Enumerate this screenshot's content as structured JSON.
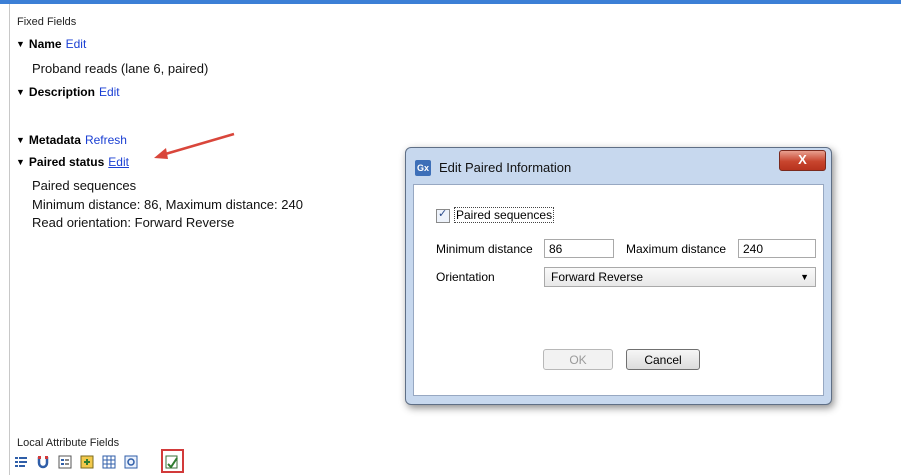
{
  "fixed_fields": {
    "title": "Fixed Fields",
    "name": {
      "label": "Name",
      "edit": "Edit",
      "value": "Proband reads (lane 6, paired)"
    },
    "description": {
      "label": "Description",
      "edit": "Edit"
    },
    "metadata": {
      "label": "Metadata",
      "refresh": "Refresh"
    },
    "paired_status": {
      "label": "Paired status",
      "edit": "Edit",
      "lines": [
        "Paired sequences",
        "Minimum distance: 86, Maximum distance: 240",
        "Read orientation: Forward Reverse"
      ]
    }
  },
  "dialog": {
    "icon_text": "Gx",
    "title": "Edit Paired Information",
    "close": "X",
    "paired_sequences_label": "Paired sequences",
    "paired_sequences_checked": true,
    "min_label": "Minimum distance",
    "min_value": "86",
    "max_label": "Maximum distance",
    "max_value": "240",
    "orientation_label": "Orientation",
    "orientation_value": "Forward Reverse",
    "ok": "OK",
    "cancel": "Cancel"
  },
  "local_attributes": {
    "title": "Local Attribute Fields",
    "toolbar_icons": [
      "list-icon",
      "magnet-icon",
      "form-icon",
      "add-field-icon",
      "table-icon",
      "settings-icon",
      "edit-paired-icon"
    ]
  }
}
